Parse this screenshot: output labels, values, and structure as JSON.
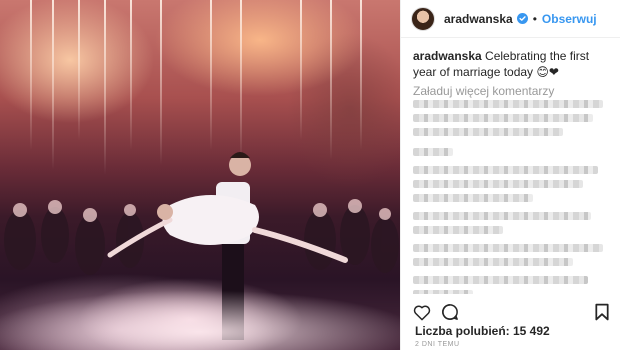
{
  "post": {
    "username": "aradwanska",
    "follow_label": "Obserwuj",
    "separator": "•",
    "caption_user": "aradwanska",
    "caption_text": " Celebrating the first year of marriage today 😊❤",
    "load_more": "Załaduj więcej komentarzy",
    "likes": "Liczba polubień: 15 492",
    "timestamp": "2 DNI TEMU"
  },
  "colors": {
    "accent": "#3897f0",
    "muted": "#999999",
    "text": "#262626"
  },
  "icons": [
    "verified-badge-icon",
    "heart-icon",
    "comment-icon",
    "bookmark-icon"
  ]
}
